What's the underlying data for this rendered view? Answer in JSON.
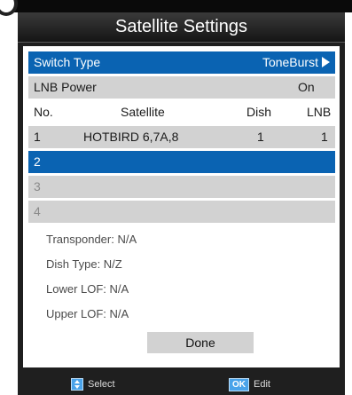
{
  "title": "Satellite Settings",
  "settings": {
    "switch_type": {
      "label": "Switch Type",
      "value": "ToneBurst"
    },
    "lnb_power": {
      "label": "LNB Power",
      "value": "On"
    }
  },
  "table": {
    "headers": {
      "no": "No.",
      "satellite": "Satellite",
      "dish": "Dish",
      "lnb": "LNB"
    },
    "rows": [
      {
        "no": "1",
        "satellite": "HOTBIRD 6,7A,8",
        "dish": "1",
        "lnb": "1"
      },
      {
        "no": "2",
        "satellite": "",
        "dish": "",
        "lnb": ""
      },
      {
        "no": "3",
        "satellite": "",
        "dish": "",
        "lnb": ""
      },
      {
        "no": "4",
        "satellite": "",
        "dish": "",
        "lnb": ""
      }
    ]
  },
  "details": {
    "transponder": "Transponder: N/A",
    "dish_type": "Dish Type: N/Z",
    "lower_lof": "Lower LOF: N/A",
    "upper_lof": "Upper LOF: N/A"
  },
  "done_label": "Done",
  "footer": {
    "select_label": "Select",
    "ok_key": "OK",
    "edit_label": "Edit"
  },
  "colors": {
    "highlight": "#0a63b2",
    "row_bg": "#d2d2d2",
    "key_blue": "#4aa3ea"
  }
}
